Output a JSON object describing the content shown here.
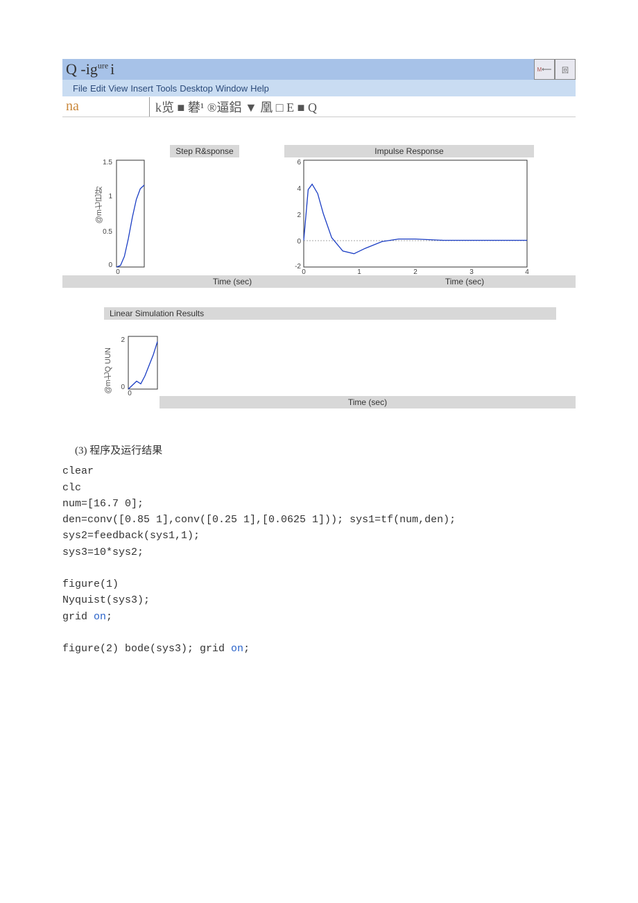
{
  "window": {
    "title_prefix": "Q -ig",
    "title_suffix": "i",
    "title_sup": "ure ",
    "min_label": "⟵",
    "max_label": "回"
  },
  "menu": {
    "items": [
      "File",
      "Edit",
      "View",
      "Insert",
      "Tools",
      "Desktop",
      "Window",
      "Help"
    ]
  },
  "toolbar": {
    "left": "na",
    "icons": "k览 ■ 礬¹  ®逼鋁 ▼ 凰 □ E ■ Q"
  },
  "chart_data": [
    {
      "type": "line",
      "title": "Step R&sponse",
      "xlabel": "Time (sec)",
      "ylabel": "@m七已好",
      "xlim": [
        0,
        0.35
      ],
      "ylim": [
        0,
        1.5
      ],
      "yticks": [
        0,
        0.5,
        1,
        1.5
      ],
      "xticks": [
        0
      ],
      "x": [
        0,
        0.05,
        0.1,
        0.15,
        0.2,
        0.25,
        0.3,
        0.35
      ],
      "values": [
        0,
        0.02,
        0.15,
        0.4,
        0.7,
        0.95,
        1.1,
        1.15
      ]
    },
    {
      "type": "line",
      "title": "Impulse Response",
      "xlabel": "Time (sec)",
      "ylabel": "",
      "xlim": [
        0,
        4
      ],
      "ylim": [
        -2,
        6
      ],
      "yticks": [
        -2,
        0,
        2,
        4,
        6
      ],
      "xticks": [
        0,
        1,
        2,
        3,
        4
      ],
      "x": [
        0,
        0.08,
        0.15,
        0.25,
        0.35,
        0.5,
        0.7,
        0.9,
        1.1,
        1.4,
        1.7,
        2.0,
        2.5,
        3.0,
        3.5,
        4.0
      ],
      "values": [
        0,
        3.8,
        4.2,
        3.5,
        2.0,
        0.2,
        -0.8,
        -1.0,
        -0.6,
        -0.1,
        0.1,
        0.1,
        0.0,
        0.0,
        0.0,
        0.0
      ],
      "has_zero_line": true
    },
    {
      "type": "line",
      "title": "Linear Simulation Results",
      "xlabel": "Time (sec)",
      "ylabel": "@m七Q UUN",
      "xlim": [
        0,
        0.35
      ],
      "ylim": [
        0,
        2
      ],
      "yticks": [
        0,
        2
      ],
      "xticks": [
        0
      ],
      "x": [
        0,
        0.1,
        0.15,
        0.2,
        0.3,
        0.35
      ],
      "values": [
        0,
        0.3,
        0.2,
        0.5,
        1.3,
        1.8
      ]
    }
  ],
  "code": {
    "heading": "(3) 程序及运行结果",
    "body": "clear\nclc\nnum=[16.7 0];\nden=conv([0.85 1],conv([0.25 1],[0.0625 1])); sys1=tf(num,den);\nsys2=feedback(sys1,1);\nsys3=10*sys2;\n\nfigure(1)\nNyquist(sys3);\ngrid on;\n\nfigure(2) bode(sys3); grid on;"
  }
}
